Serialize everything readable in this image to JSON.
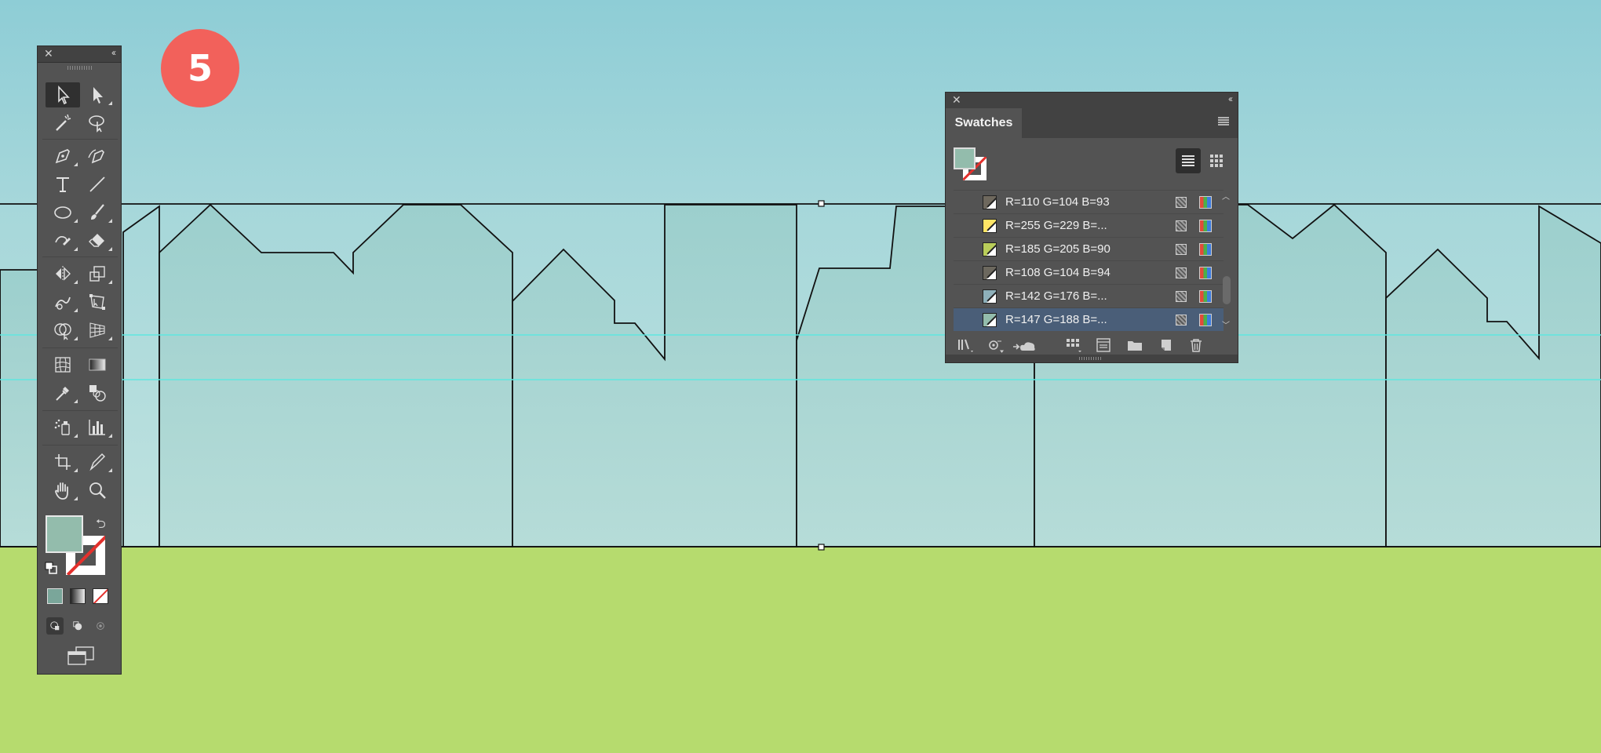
{
  "step": {
    "number": "5"
  },
  "canvas": {
    "sky_top_color": "#8ecdd6",
    "sky_bottom_color": "#bfe2df",
    "ground_color": "#b6db6e",
    "guide_color": "#5fe7e0",
    "building_fill": "#a4d2cf",
    "stroke_color": "#111111"
  },
  "tools_panel": {
    "close_glyph": "✕",
    "collapse_glyph": "‹‹",
    "fill_color": "#93bcac",
    "tools": [
      "selection-tool",
      "direct-selection-tool",
      "magic-wand-tool",
      "lasso-tool",
      "pen-tool",
      "curvature-tool",
      "type-tool",
      "line-segment-tool",
      "ellipse-tool",
      "paintbrush-tool",
      "shaper-tool",
      "eraser-tool",
      "reflect-tool",
      "scale-tool",
      "warp-tool",
      "free-transform-tool",
      "shape-builder-tool",
      "perspective-grid-tool",
      "mesh-tool",
      "gradient-tool",
      "eyedropper-tool",
      "blend-tool",
      "symbol-sprayer-tool",
      "column-graph-tool",
      "artboard-tool",
      "slice-tool",
      "hand-tool",
      "zoom-tool"
    ]
  },
  "swatches_panel": {
    "close_glyph": "✕",
    "collapse_glyph": "‹‹",
    "tab_label": "Swatches",
    "fill_color": "#93bcac",
    "rows": [
      {
        "label": "R=110 G=104 B=93",
        "color": "#6e685d",
        "selected": false
      },
      {
        "label": "R=255 G=229 B=...",
        "color": "#ffe566",
        "selected": false
      },
      {
        "label": "R=185 G=205 B=90",
        "color": "#b9cd5a",
        "selected": false
      },
      {
        "label": "R=108 G=104 B=94",
        "color": "#6c685e",
        "selected": false
      },
      {
        "label": "R=142 G=176 B=...",
        "color": "#8eb0ba",
        "selected": false
      },
      {
        "label": "R=147 G=188 B=...",
        "color": "#93bcac",
        "selected": true
      }
    ],
    "bottom_icons": [
      "swatch-libraries-icon",
      "show-kinds-icon",
      "cloud-sync-icon",
      "color-group-icon",
      "swatch-options-icon",
      "new-group-icon",
      "new-swatch-icon",
      "delete-swatch-icon"
    ]
  }
}
